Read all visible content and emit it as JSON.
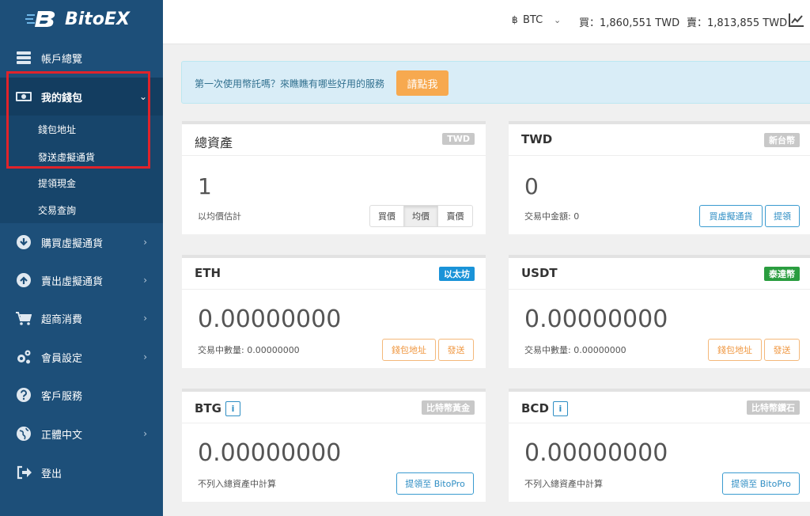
{
  "brand": {
    "name": "BitoEX"
  },
  "sidebar": {
    "items": [
      {
        "label": "帳戶總覽",
        "icon": "server-icon"
      },
      {
        "label": "我的錢包",
        "icon": "wallet-icon"
      },
      {
        "label": "購買虛擬通貨",
        "icon": "download-circle-icon"
      },
      {
        "label": "賣出虛擬通貨",
        "icon": "upload-circle-icon"
      },
      {
        "label": "超商消費",
        "icon": "cart-icon"
      },
      {
        "label": "會員設定",
        "icon": "gears-icon"
      },
      {
        "label": "客戶服務",
        "icon": "question-circle-icon"
      },
      {
        "label": "正體中文",
        "icon": "globe-icon"
      },
      {
        "label": "登出",
        "icon": "sign-out-icon"
      }
    ],
    "wallet_sub": [
      "錢包地址",
      "發送虛擬通貨",
      "提領現金",
      "交易查詢"
    ]
  },
  "topbar": {
    "currency_symbol": "฿",
    "currency": "BTC",
    "buy": "買：1,860,551 TWD",
    "sell": "賣：1,813,855 TWD"
  },
  "banner": {
    "text": "第一次使用幣託嗎？來瞧瞧有哪些好用的服務",
    "button": "請點我"
  },
  "cards": {
    "total": {
      "title": "總資產",
      "badge": "TWD",
      "value": "1",
      "label": "以均價估計",
      "seg": [
        "買價",
        "均價",
        "賣價"
      ]
    },
    "twd": {
      "title": "TWD",
      "badge": "新台幣",
      "value": "0",
      "label": "交易中金額: 0",
      "btn1": "買虛擬通貨",
      "btn2": "提領"
    },
    "eth": {
      "title": "ETH",
      "badge": "以太坊",
      "value": "0.00000000",
      "label": "交易中數量: 0.00000000",
      "btn1": "錢包地址",
      "btn2": "發送"
    },
    "usdt": {
      "title": "USDT",
      "badge": "泰達幣",
      "value": "0.00000000",
      "label": "交易中數量: 0.00000000",
      "btn1": "錢包地址",
      "btn2": "發送"
    },
    "btg": {
      "title": "BTG",
      "info": "i",
      "badge": "比特幣黃金",
      "value": "0.00000000",
      "label": "不列入總資產中計算",
      "btn1": "提領至 BitoPro"
    },
    "bcd": {
      "title": "BCD",
      "info": "i",
      "badge": "比特幣鑽石",
      "value": "0.00000000",
      "label": "不列入總資產中計算",
      "btn1": "提領至 BitoPro"
    }
  },
  "colors": {
    "sidebar": "#1d4f79",
    "badge_gray": "#c8c8c8",
    "badge_eth": "#1a93d8",
    "badge_usdt": "#2a9d3f",
    "highlight": "#e0232a"
  }
}
